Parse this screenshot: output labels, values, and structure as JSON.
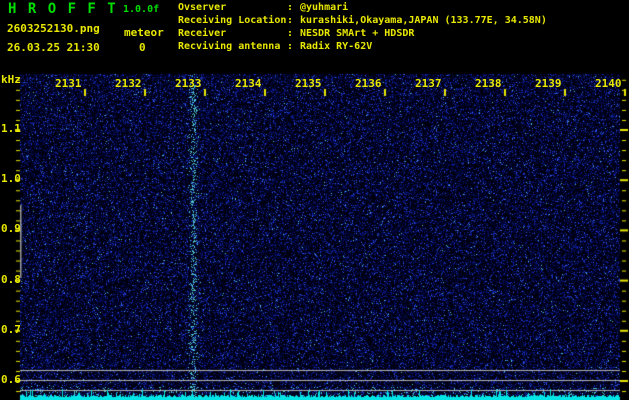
{
  "header": {
    "app_title": "H R O F F T",
    "version": "1.0.0f",
    "filename": "2603252130.png",
    "counter_label": "meteor",
    "counter_value": "0",
    "datetime": "26.03.25 21:30",
    "info": [
      {
        "label": "Ovserver",
        "sep": ":",
        "value": "@yuhmari"
      },
      {
        "label": "Receiving Location",
        "sep": ":",
        "value": "kurashiki,Okayama,JAPAN (133.77E, 34.58N)"
      },
      {
        "label": "Receiver",
        "sep": ":",
        "value": "NESDR SMArt + HDSDR"
      },
      {
        "label": "Recviving antenna",
        "sep": ":",
        "value": "Radix RY-62V"
      }
    ]
  },
  "chart": {
    "type": "spectrogram",
    "y_axis": {
      "unit": "kHz",
      "tick_labels": [
        "1.1",
        "1.0",
        "0.9",
        "0.8",
        "0.7",
        "0.6"
      ],
      "range_khz": [
        0.56,
        1.21
      ]
    },
    "x_axis": {
      "unit": "time HHMM",
      "tick_labels": [
        "2131",
        "2132",
        "2133",
        "2134",
        "2135",
        "2136",
        "2137",
        "2138",
        "2139",
        "2140"
      ]
    },
    "features": {
      "vertical_streak_at": "2133",
      "detection_band_marker_khz": [
        0.8,
        0.94
      ],
      "reference_lines_count": 3,
      "noise_floor_strip": "cyan level graph along bottom edge"
    }
  },
  "colors": {
    "background": "#000000",
    "text_green": "#00dd00",
    "text_yellow": "#e8e800",
    "ref_gray": "#b2b2b2",
    "marker_gray": "#9a9a9a",
    "level_cyan": "#00e6e6"
  }
}
